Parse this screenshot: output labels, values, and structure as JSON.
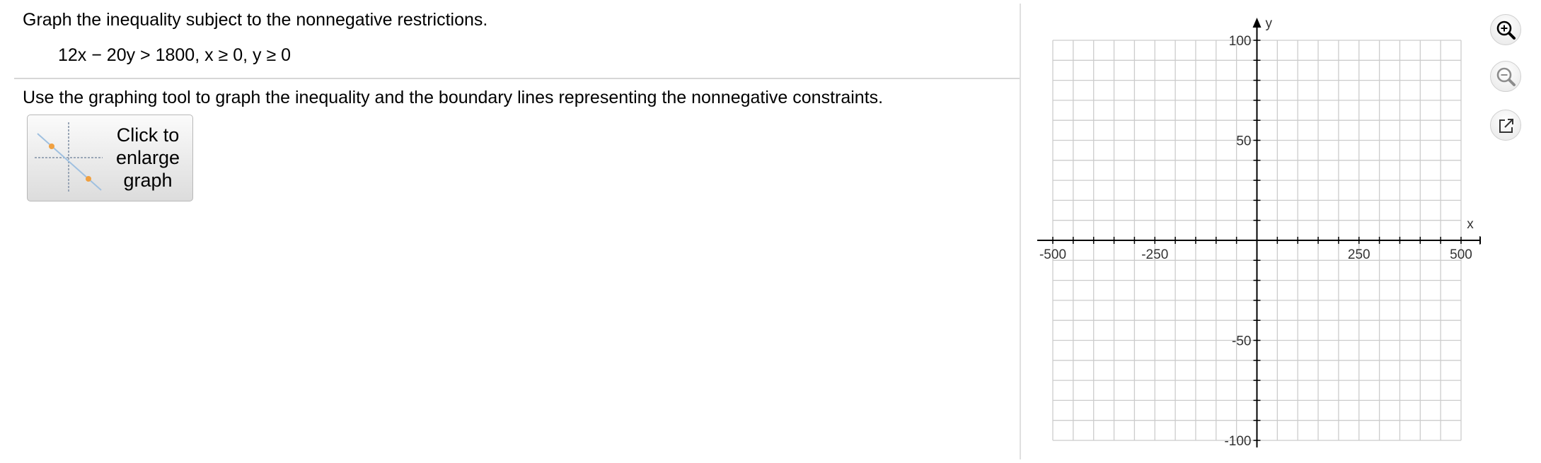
{
  "question": {
    "title": "Graph the inequality subject to the nonnegative restrictions.",
    "equation": "12x − 20y > 1800, x ≥ 0, y ≥ 0",
    "instructions": "Use the graphing tool to graph the inequality and the boundary lines representing the nonnegative constraints."
  },
  "enlarge_button": {
    "label": "Click to\nenlarge\ngraph"
  },
  "graph": {
    "x_axis_label": "x",
    "y_axis_label": "y",
    "x_min": -500,
    "x_max": 500,
    "x_grid_step": 50,
    "y_min": -100,
    "y_max": 100,
    "y_grid_step": 10,
    "x_tick_labels": [
      "-500",
      "-250",
      "250",
      "500"
    ],
    "y_tick_labels": [
      "100",
      "50",
      "-50",
      "-100"
    ],
    "grid_color": "#cccccc",
    "axis_color": "#000000"
  },
  "tools": [
    {
      "name": "zoom-in-icon",
      "color": "#000000"
    },
    {
      "name": "zoom-out-icon",
      "color": "#8c8c8c"
    },
    {
      "name": "popout-icon",
      "color": "#333333"
    }
  ]
}
